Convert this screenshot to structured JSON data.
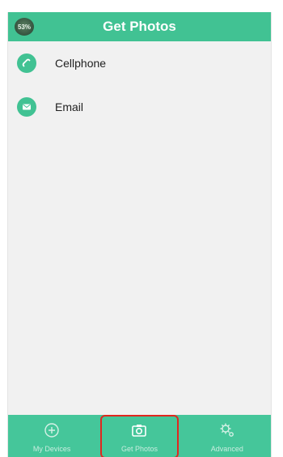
{
  "status": {
    "battery": "53%"
  },
  "header": {
    "title": "Get Photos"
  },
  "menu": {
    "items": [
      {
        "label": "Cellphone",
        "icon": "phone-icon"
      },
      {
        "label": "Email",
        "icon": "envelope-icon"
      }
    ]
  },
  "tabbar": {
    "tabs": [
      {
        "label": "My Devices",
        "icon": "add-circle-icon",
        "active": false
      },
      {
        "label": "Get Photos",
        "icon": "camera-icon",
        "active": true
      },
      {
        "label": "Advanced",
        "icon": "gear-icon",
        "active": false
      }
    ]
  },
  "colors": {
    "accent": "#41c293",
    "highlight": "#e0271f",
    "background": "#f1f1f1"
  }
}
